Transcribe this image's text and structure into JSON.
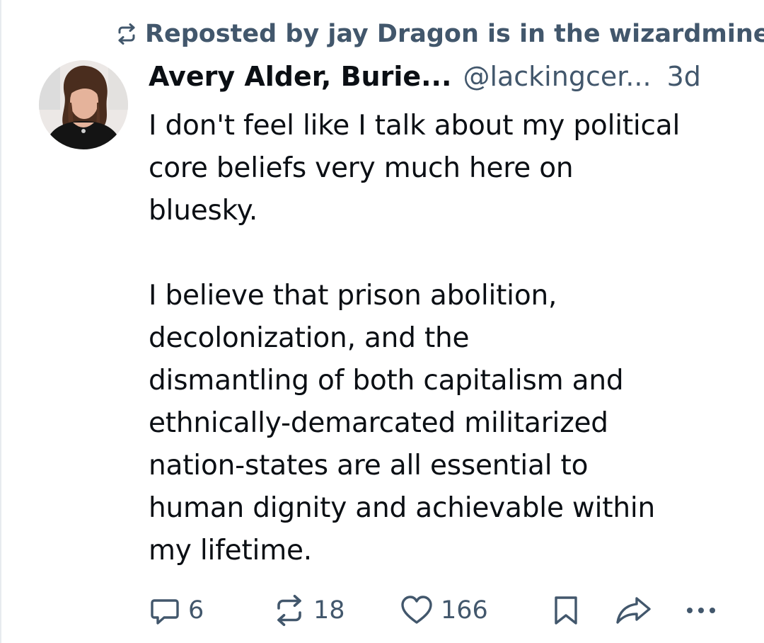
{
  "repost": {
    "icon": "repost-icon",
    "text": "Reposted by jay Dragon is in the wizardmines"
  },
  "post": {
    "avatar": "avatar-photo",
    "display_name": "Avery Alder, Burie...",
    "handle": "@lackingcer...",
    "timestamp": "3d",
    "lines": [
      "I don't feel like I talk about my political",
      "core beliefs very much here on",
      "bluesky.",
      "",
      "I believe that prison abolition,",
      "decolonization, and the",
      "dismantling of both capitalism and",
      "ethnically-demarcated militarized",
      "nation-states are all essential to",
      "human dignity and achievable within",
      "my lifetime."
    ]
  },
  "actions": {
    "reply": {
      "icon": "reply-icon",
      "count": "6"
    },
    "repost": {
      "icon": "repost-icon",
      "count": "18"
    },
    "like": {
      "icon": "heart-icon",
      "count": "166"
    },
    "bookmark": {
      "icon": "bookmark-icon"
    },
    "share": {
      "icon": "share-icon"
    },
    "more": {
      "icon": "more-icon"
    }
  },
  "colors": {
    "text": "#0b0f14",
    "muted": "#42576c",
    "background": "#ffffff"
  }
}
